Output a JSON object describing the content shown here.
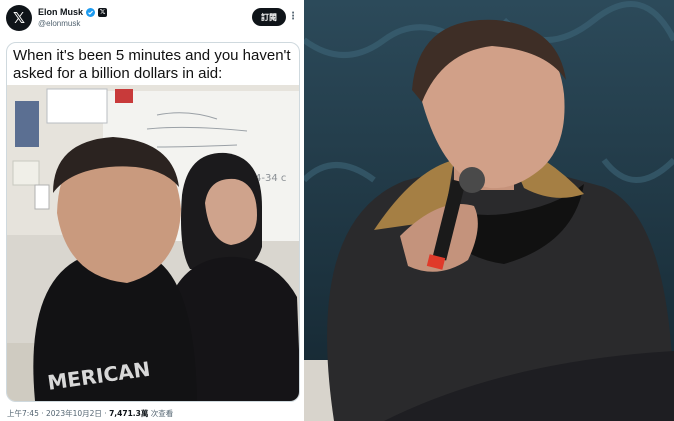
{
  "tweet": {
    "display_name": "Elon Musk",
    "handle": "@elonmusk",
    "logo_glyph": "𝕏",
    "x_badge_glyph": "𝕏",
    "subscribe_label": "訂閱",
    "more_glyph": "⋮",
    "caption": "When it's been 5 minutes and you haven't asked for a billion dollars in aid:",
    "shirt_text": "MERICAN",
    "meta": {
      "time": "上午7:45",
      "separator": " · ",
      "date": "2023年10月2日",
      "views": "7,471.3萬",
      "views_label": " 次查看"
    },
    "icons": {
      "logo": "x-logo-icon",
      "verified": "verified-badge-icon",
      "affiliation": "x-affiliation-icon",
      "more": "more-icon"
    }
  },
  "colors": {
    "verified_blue": "#1d9bf0",
    "text_primary": "#0f1419",
    "text_secondary": "#536471",
    "card_border": "#cfd9de",
    "photo_backdrop": "#2f4f5f"
  }
}
